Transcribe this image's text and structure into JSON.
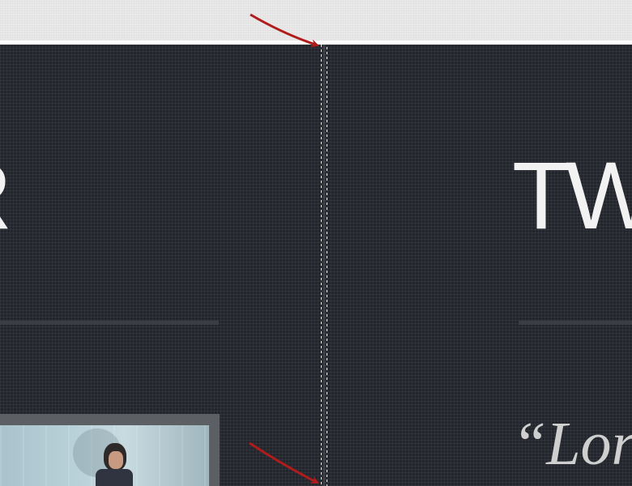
{
  "left_column": {
    "heading_fragment": "R"
  },
  "right_column": {
    "heading_fragment": "TW",
    "quote_fragment": "“Lor"
  },
  "photo": {
    "description_icon": "person-photo"
  },
  "annotations": {
    "arrow_color": "#b01c1c",
    "arrow_icon": "arrow-pointer-icon"
  },
  "colors": {
    "panel_background": "#22262c",
    "heading_text": "#f2f2f2",
    "divider": "#ffffff"
  }
}
